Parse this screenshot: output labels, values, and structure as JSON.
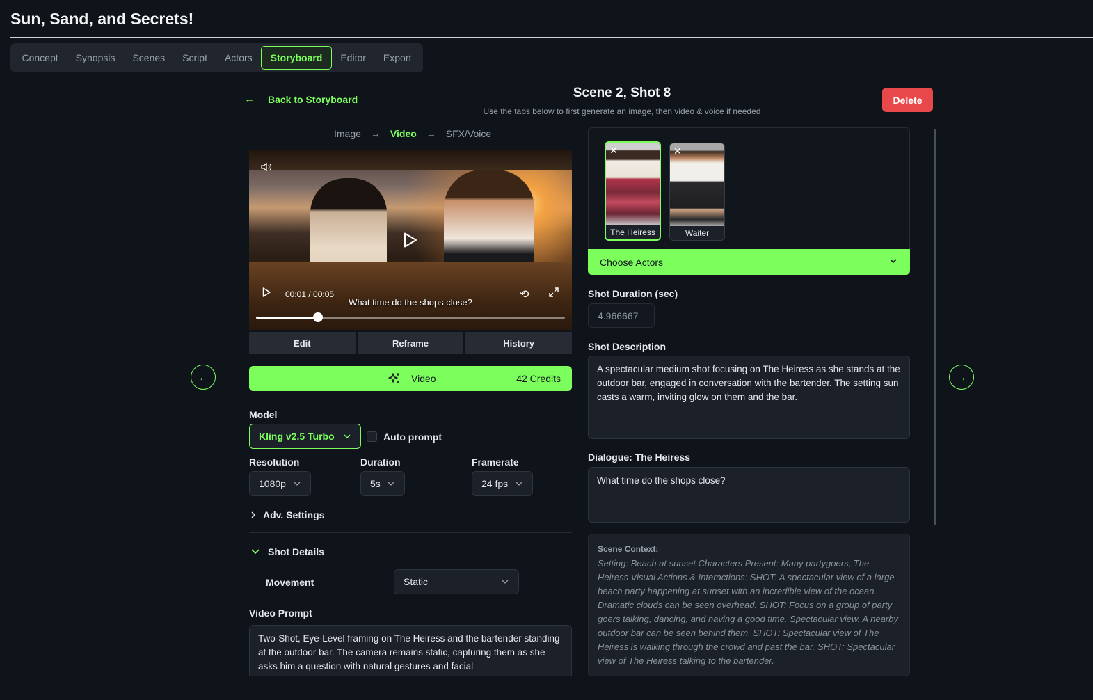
{
  "app": {
    "title": "Sun, Sand, and Secrets!"
  },
  "tabs": [
    {
      "label": "Concept"
    },
    {
      "label": "Synopsis"
    },
    {
      "label": "Scenes"
    },
    {
      "label": "Script"
    },
    {
      "label": "Actors"
    },
    {
      "label": "Storyboard",
      "active": true
    },
    {
      "label": "Editor"
    },
    {
      "label": "Export"
    }
  ],
  "header": {
    "back_label": "Back to Storyboard",
    "shot_title": "Scene 2, Shot 8",
    "subtitle": "Use the tabs below to first generate an image, then video & voice if needed",
    "delete_label": "Delete"
  },
  "steps": {
    "image": "Image",
    "video": "Video",
    "sfx": "SFX/Voice",
    "active": "Video"
  },
  "player": {
    "time": "00:01 / 00:05",
    "caption": "What time do the shops close?",
    "progress": 0.2,
    "icons": [
      "volume-icon",
      "play-icon",
      "loop-icon",
      "fullscreen-icon"
    ]
  },
  "video_actions": {
    "edit": "Edit",
    "reframe": "Reframe",
    "history": "History"
  },
  "generate": {
    "label": "Video",
    "credits": "42 Credits",
    "icon": "sparkle-icon"
  },
  "settings": {
    "model_label": "Model",
    "model_value": "Kling v2.5 Turbo",
    "auto_prompt_label": "Auto prompt",
    "auto_prompt_checked": false,
    "resolution_label": "Resolution",
    "resolution_value": "1080p",
    "duration_label": "Duration",
    "duration_value": "5s",
    "framerate_label": "Framerate",
    "framerate_value": "24 fps",
    "adv_settings_label": "Adv. Settings",
    "shot_details_label": "Shot Details",
    "movement_label": "Movement",
    "movement_value": "Static",
    "video_prompt_label": "Video Prompt",
    "video_prompt_value": "Two-Shot, Eye-Level framing on The Heiress and the bartender standing at the outdoor bar. The camera remains static, capturing them as she asks him a question with natural gestures and facial"
  },
  "actors": {
    "items": [
      {
        "name": "The Heiress",
        "selected": true
      },
      {
        "name": "Waiter",
        "selected": false
      }
    ],
    "choose_label": "Choose Actors"
  },
  "shot": {
    "duration_label": "Shot Duration (sec)",
    "duration_value": "4.966667",
    "description_label": "Shot Description",
    "description_value": "A spectacular medium shot focusing on The Heiress as she stands at the outdoor bar, engaged in conversation with the bartender. The setting sun casts a warm, inviting glow on them and the bar.",
    "dialogue_label": "Dialogue: The Heiress",
    "dialogue_value": "What time do the shops close?",
    "context_title": "Scene Context:",
    "context_body": "Setting: Beach at sunset Characters Present: Many partygoers, The Heiress Visual Actions & Interactions: SHOT: A spectacular view of a large beach party happening at sunset with an incredible view of the ocean. Dramatic clouds can be seen overhead. SHOT: Focus on a group of party goers talking, dancing, and having a good time. Spectacular view. A nearby outdoor bar can be seen behind them. SHOT: Spectacular view of The Heiress is walking through the crowd and past the bar. SHOT: Spectacular view of The Heiress talking to the bartender."
  },
  "colors": {
    "accent": "#7cff5c",
    "danger": "#e8484a",
    "background": "#0f131a",
    "panel": "#1b2029"
  }
}
